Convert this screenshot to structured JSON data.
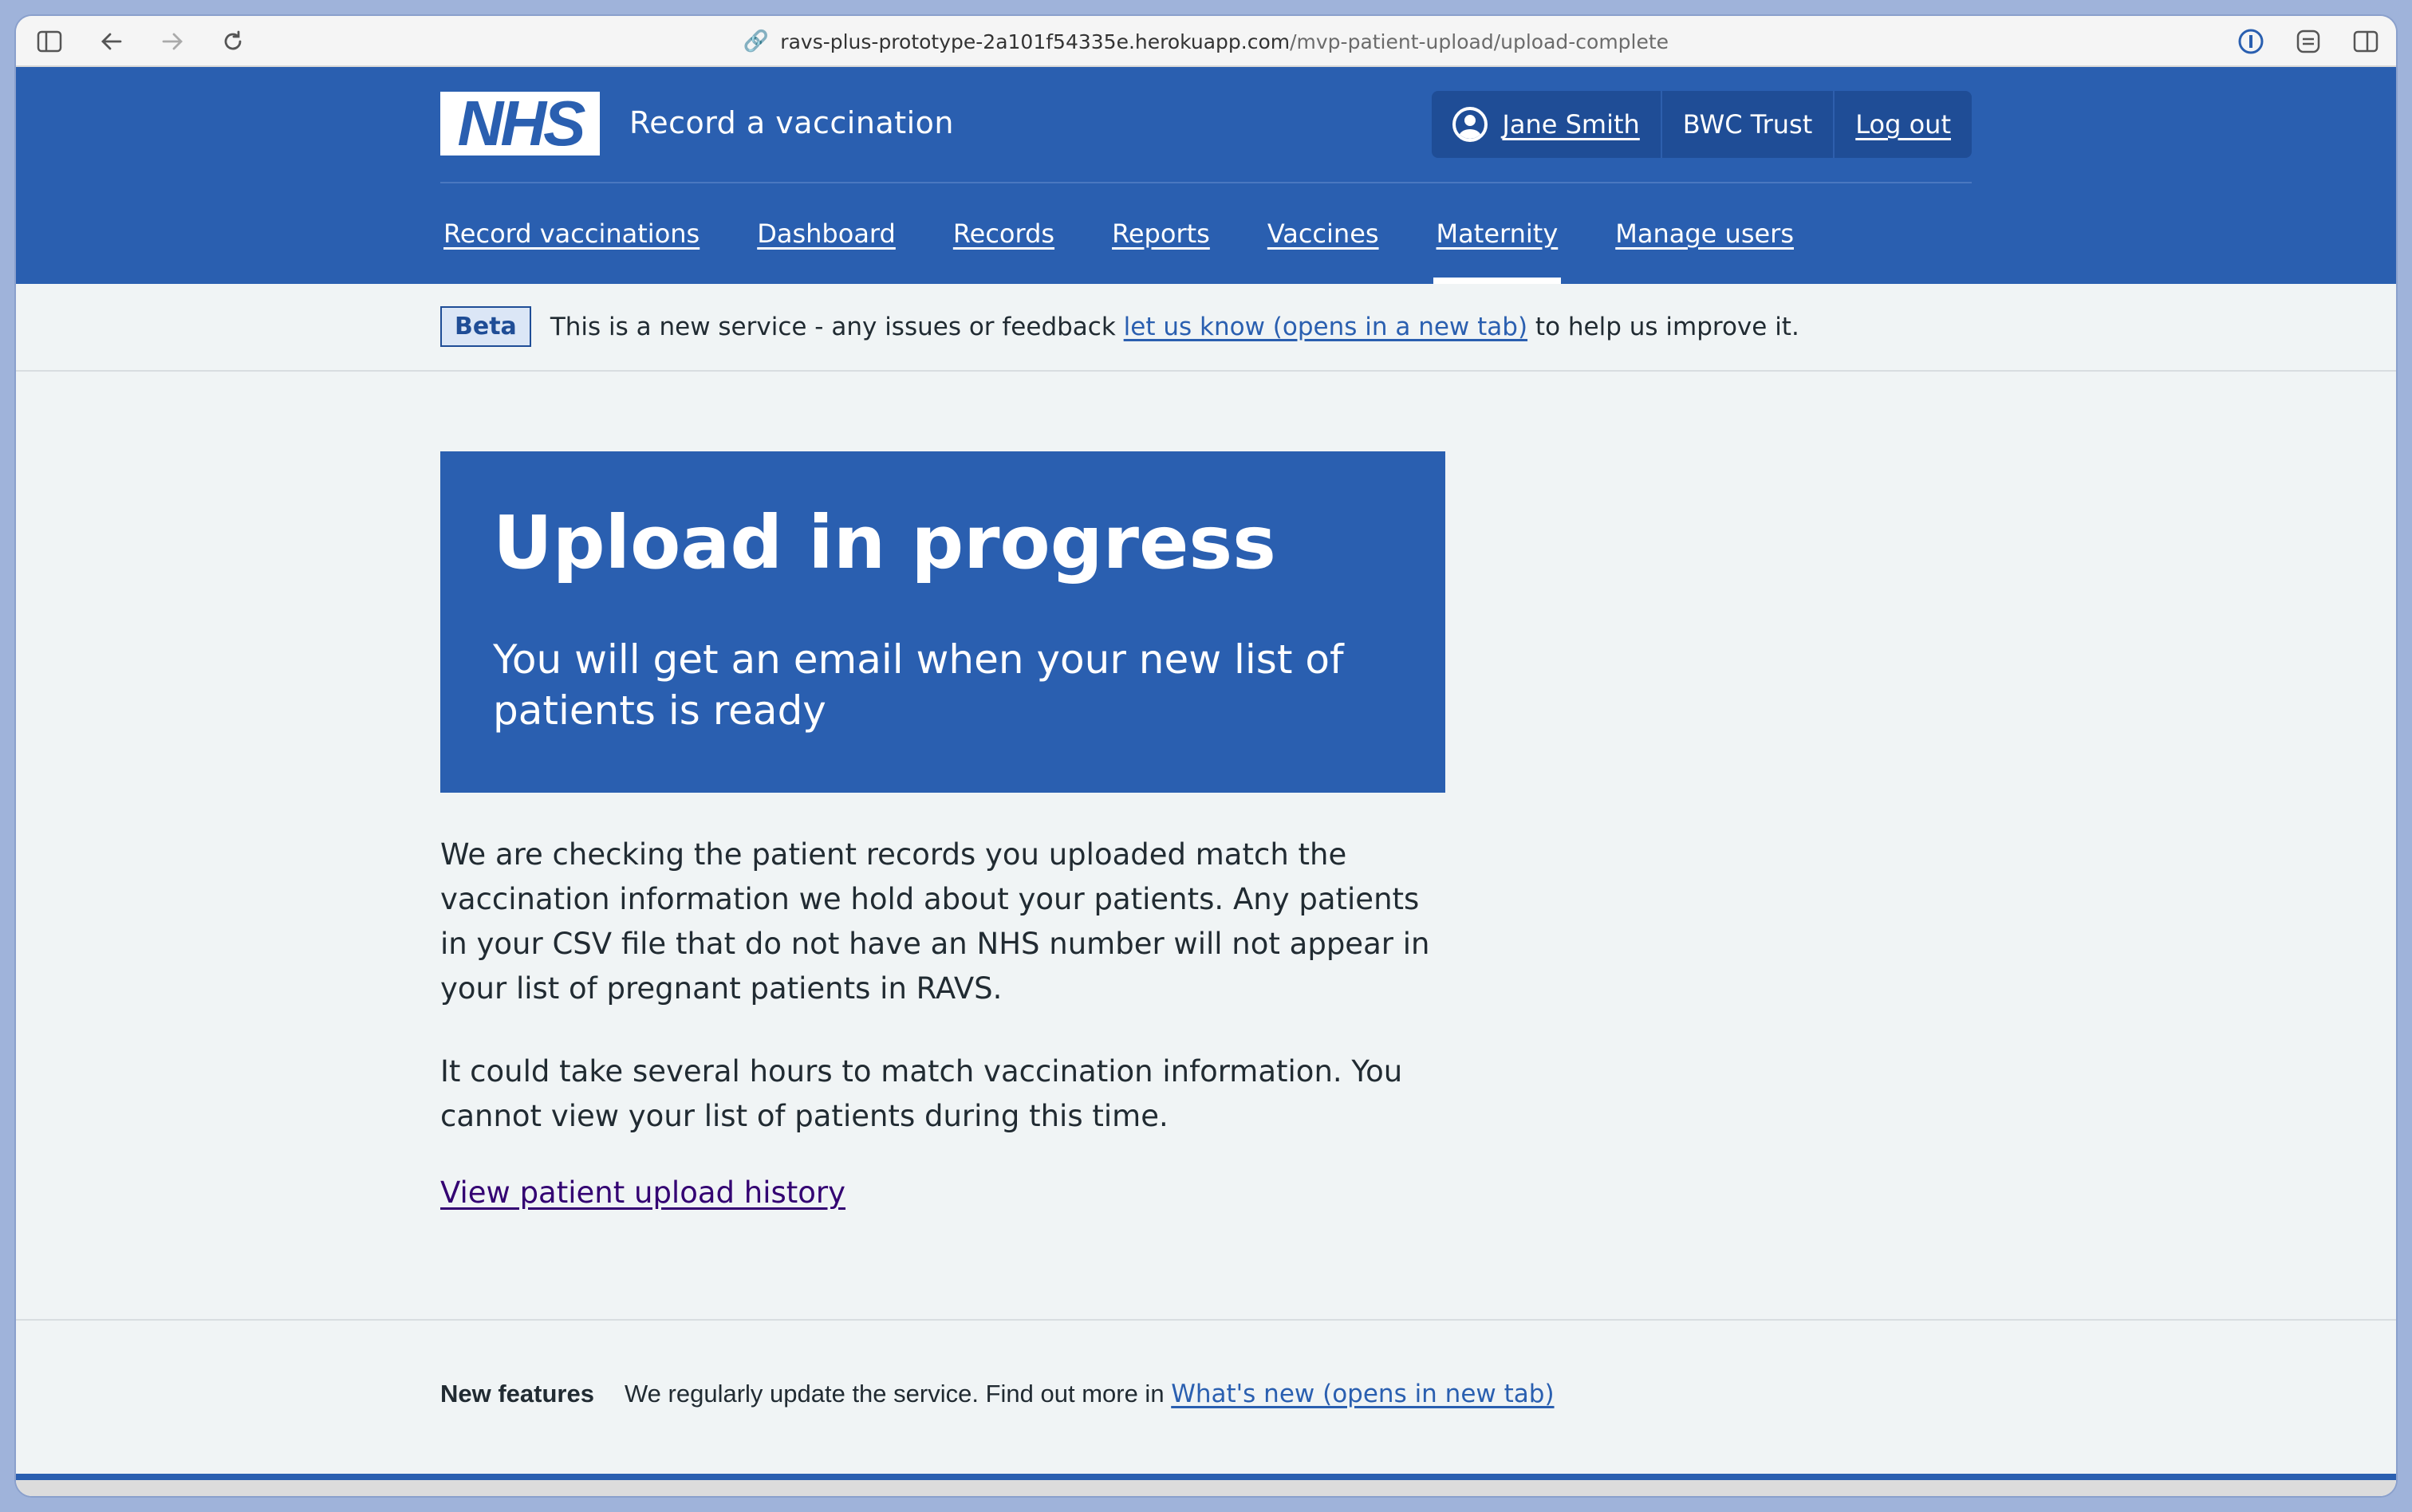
{
  "browser": {
    "url_host": "ravs-plus-prototype-2a101f54335e.herokuapp.com",
    "url_path": "/mvp-patient-upload/upload-complete"
  },
  "header": {
    "logo_text": "NHS",
    "service_name": "Record a vaccination",
    "account": {
      "user_name": "Jane Smith",
      "organisation": "BWC Trust",
      "logout_label": "Log out"
    },
    "nav": [
      {
        "label": "Record vaccinations",
        "active": false
      },
      {
        "label": "Dashboard",
        "active": false
      },
      {
        "label": "Records",
        "active": false
      },
      {
        "label": "Reports",
        "active": false
      },
      {
        "label": "Vaccines",
        "active": false
      },
      {
        "label": "Maternity",
        "active": true
      },
      {
        "label": "Manage users",
        "active": false
      }
    ]
  },
  "beta_banner": {
    "tag": "Beta",
    "text_before": "This is a new service - any issues or feedback ",
    "link_text": "let us know (opens in a new tab)",
    "text_after": " to help us improve it."
  },
  "panel": {
    "title": "Upload in progress",
    "subtitle": "You will get an email when your new list of patients is ready"
  },
  "body": {
    "paragraph_1": "We are checking the patient records you uploaded match the vaccination information we hold about your patients. Any patients in your CSV file that do not have an NHS number will not appear in your list of pregnant patients in RAVS.",
    "paragraph_2": "It could take several hours to match vaccination information. You cannot view your list of patients during this time.",
    "history_link": "View patient upload history"
  },
  "footer": {
    "label": "New features",
    "text": "We regularly update the service. Find out more in ",
    "link_text": "What's new (opens in new tab)"
  },
  "colors": {
    "nhs_blue": "#2a5fb0",
    "dark_blue": "#1f4d96",
    "background": "#f0f4f5",
    "visited_link": "#330072"
  }
}
